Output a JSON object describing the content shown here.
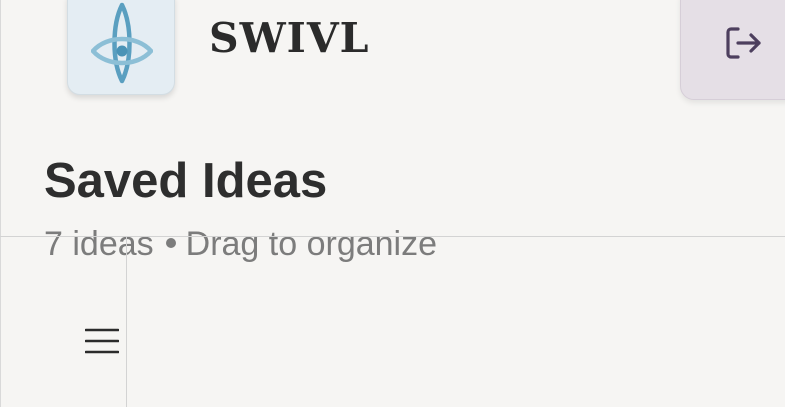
{
  "header": {
    "brand_name": "SWIVL",
    "logo_icon": "eye-diamond-icon",
    "logout_icon": "logout-icon"
  },
  "main": {
    "title": "Saved Ideas",
    "subtitle_count": "7 ideas",
    "subtitle_hint": "Drag to organize"
  },
  "sidebar": {
    "menu_icon": "hamburger-menu-icon"
  },
  "colors": {
    "background": "#f6f5f3",
    "logo_tile": "#e4edf3",
    "logo_accent": "#5a9fc0",
    "logout_tile": "#e5dfe6",
    "logout_accent": "#4d3f5e",
    "text_primary": "#2e2e2e",
    "text_secondary": "#7c7c7c"
  }
}
